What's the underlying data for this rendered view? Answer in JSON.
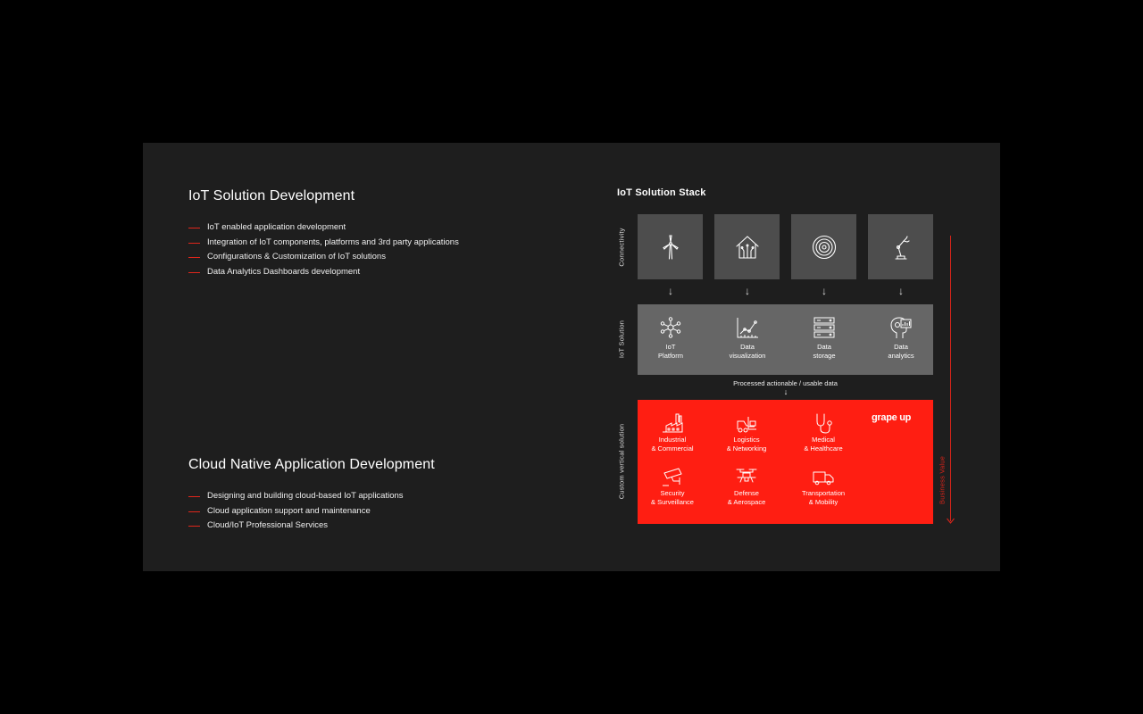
{
  "sections": [
    {
      "title": "IoT Solution Development",
      "items": [
        "IoT enabled application development",
        "Integration of IoT components, platforms and 3rd party applications",
        "Configurations & Customization of IoT solutions",
        "Data Analytics Dashboards development"
      ]
    },
    {
      "title": "Cloud Native Application Development",
      "items": [
        "Designing and building cloud-based IoT applications",
        "Cloud application support and maintenance",
        "Cloud/IoT Professional Services"
      ]
    }
  ],
  "stack": {
    "title": "IoT Solution Stack",
    "row_labels": {
      "connectivity": "Connectivity",
      "solution": "IoT Solution",
      "vertical": "Custom vertical solution"
    },
    "connectivity_icons": [
      "wind-turbine-icon",
      "smart-home-icon",
      "signal-waves-icon",
      "robotic-arm-icon"
    ],
    "arrow_glyph": "↓",
    "solution_items": [
      {
        "label": "IoT\nPlatform",
        "icon": "network-hub-icon"
      },
      {
        "label": "Data\nvisualization",
        "icon": "line-chart-icon"
      },
      {
        "label": "Data\nstorage",
        "icon": "server-stack-icon"
      },
      {
        "label": "Data\nanalytics",
        "icon": "analytics-head-icon"
      }
    ],
    "processed_text": "Processed actionable / usable data",
    "brand": "grape up",
    "vertical_items": [
      {
        "label": "Industrial\n& Commercial",
        "icon": "factory-icon"
      },
      {
        "label": "Logistics\n& Networking",
        "icon": "forklift-icon"
      },
      {
        "label": "Medical\n& Healthcare",
        "icon": "stethoscope-icon"
      },
      {
        "label": "Security\n& Surveillance",
        "icon": "security-camera-icon"
      },
      {
        "label": "Defense\n& Aerospace",
        "icon": "drone-icon"
      },
      {
        "label": "Transportation\n& Mobility",
        "icon": "truck-icon"
      }
    ],
    "business_value": "Business Value"
  },
  "colors": {
    "background": "#000000",
    "slide": "#1e1e1e",
    "accent_red": "#ff1e12",
    "dash_red": "#e0261b",
    "connectivity_box": "#4d4d4d",
    "solution_band": "#666666"
  }
}
